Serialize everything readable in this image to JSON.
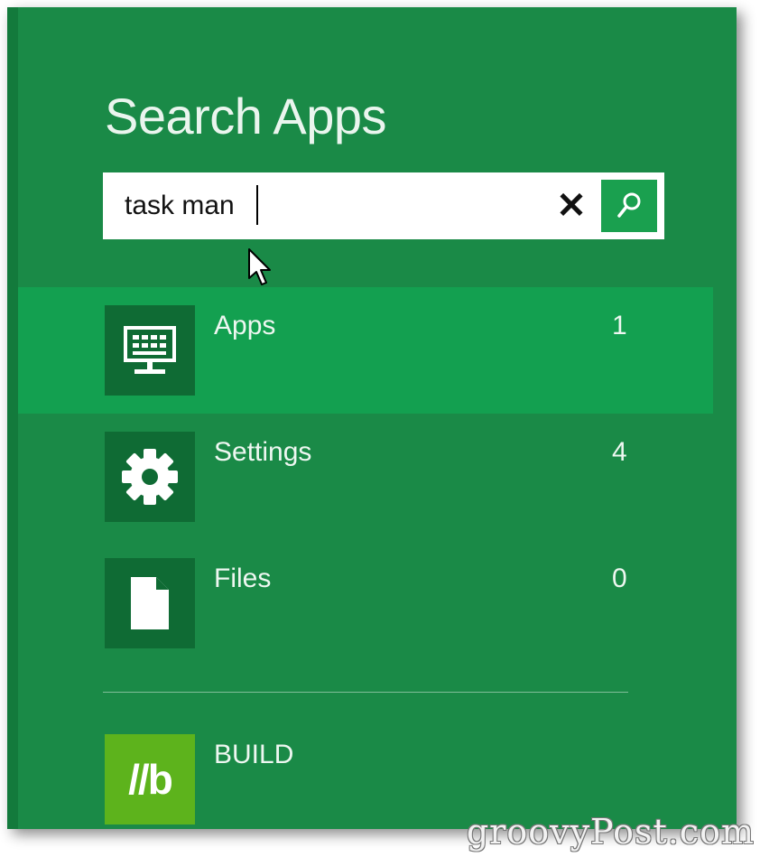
{
  "title": "Search Apps",
  "search": {
    "value": "task man"
  },
  "results": [
    {
      "label": "Apps",
      "count": "1",
      "icon": "keyboard-monitor-icon",
      "selected": true
    },
    {
      "label": "Settings",
      "count": "4",
      "icon": "gear-icon",
      "selected": false
    },
    {
      "label": "Files",
      "count": "0",
      "icon": "file-icon",
      "selected": false
    }
  ],
  "apps": [
    {
      "label": "BUILD",
      "tile_text": "//b",
      "icon": "build-logo"
    }
  ],
  "watermark": "groovyPost.com",
  "colors": {
    "panel": "#1a8a47",
    "selected": "#13a050",
    "tile": "#0f6b34",
    "search_button": "#1aa04f",
    "build_tile": "#5db31c"
  }
}
